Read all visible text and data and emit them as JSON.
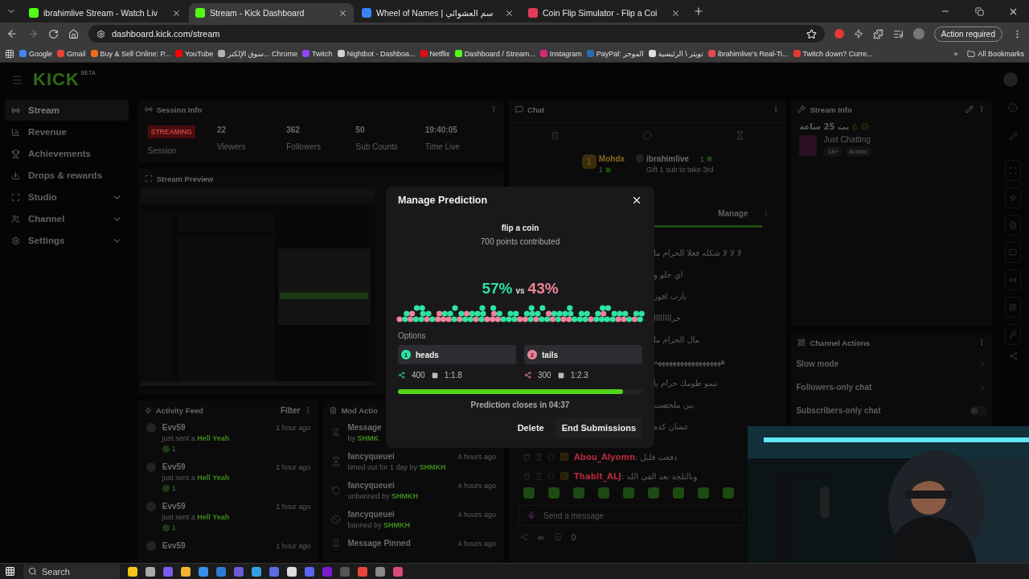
{
  "browser": {
    "tabs": [
      {
        "title": "ibrahimlive Stream - Watch Liv",
        "selected": false,
        "color": "#53fc18"
      },
      {
        "title": "Stream - Kick Dashboard",
        "selected": true,
        "color": "#53fc18"
      },
      {
        "title": "Wheel of Names | سم العشوائي",
        "selected": false,
        "color": "#3b82f6"
      },
      {
        "title": "Coin Flip Simulator - Flip a Coi",
        "selected": false,
        "color": "#e23b5a"
      }
    ],
    "address": "dashboard.kick.com/stream",
    "action_required": "Action required",
    "bookmarks": [
      {
        "label": "Google",
        "color": "#4285f4"
      },
      {
        "label": "Gmail",
        "color": "#ea4335"
      },
      {
        "label": "Buy & Sell Online: P...",
        "color": "#f26b1d"
      },
      {
        "label": "YouTube",
        "color": "#ff0000"
      },
      {
        "label": "سوق الإلكتر... Chrome",
        "color": "#b0b0b0"
      },
      {
        "label": "Twitch",
        "color": "#9146ff"
      },
      {
        "label": "Nightbot - Dashboa...",
        "color": "#d0d0d0"
      },
      {
        "label": "Netflix",
        "color": "#e50914"
      },
      {
        "label": "Dashboard / Stream...",
        "color": "#53fc18"
      },
      {
        "label": "Instagram",
        "color": "#d62976"
      },
      {
        "label": "PayPal: الموجز",
        "color": "#2b6cb0"
      },
      {
        "label": "تويتر \\ الرئيسية",
        "color": "#e0e0e0"
      },
      {
        "label": "ibrahimlive's Real-Ti...",
        "color": "#e34c4c"
      },
      {
        "label": "Twitch down? Curre...",
        "color": "#e53935"
      }
    ],
    "more": "»",
    "all_bookmarks": "All Bookmarks"
  },
  "header": {
    "logo": "KICK",
    "logo_badge": "BETA"
  },
  "sidebar": {
    "items": [
      {
        "label": "Stream",
        "selected": true,
        "kind": "stream",
        "expandable": false
      },
      {
        "label": "Revenue",
        "selected": false,
        "kind": "revenue",
        "expandable": false
      },
      {
        "label": "Achievements",
        "selected": false,
        "kind": "achievements",
        "expandable": false
      },
      {
        "label": "Drops & rewards",
        "selected": false,
        "kind": "drops",
        "expandable": false
      },
      {
        "label": "Studio",
        "selected": false,
        "kind": "studio",
        "expandable": true
      },
      {
        "label": "Channel",
        "selected": false,
        "kind": "channel",
        "expandable": true
      },
      {
        "label": "Settings",
        "selected": false,
        "kind": "settings",
        "expandable": true
      }
    ]
  },
  "session_info": {
    "title": "Session Info",
    "status": "STREAMING",
    "status_label": "Session",
    "stats": [
      {
        "value": "22",
        "label": "Viewers"
      },
      {
        "value": "362",
        "label": "Followers"
      },
      {
        "value": "50",
        "label": "Sub Counts"
      },
      {
        "value": "19:40:05",
        "label": "Time Live"
      }
    ]
  },
  "stream_preview": {
    "title": "Stream Preview"
  },
  "activity_feed": {
    "title": "Activity Feed",
    "filter": "Filter",
    "events": [
      {
        "user": "Evv59",
        "text": "just sent a",
        "reward": "Hell Yeah",
        "count": "1",
        "time": "1 hour ago"
      },
      {
        "user": "Evv59",
        "text": "just sent a",
        "reward": "Hell Yeah",
        "count": "1",
        "time": "1 hour ago"
      },
      {
        "user": "Evv59",
        "text": "just sent a",
        "reward": "Hell Yeah",
        "count": "1",
        "time": "1 hour ago"
      },
      {
        "user": "Evv59",
        "time": "1 hour ago"
      }
    ]
  },
  "mod_actions": {
    "title": "Mod Actio",
    "actions": [
      {
        "kind": "unpin",
        "title": "Message",
        "detail": "by",
        "moderator": "SHMK"
      },
      {
        "kind": "timeout",
        "title": "fancyqueuei",
        "detail": "timed out for 1 day by",
        "moderator": "SHMKH",
        "time": "4 hours ago"
      },
      {
        "kind": "unban",
        "title": "fancyqueuei",
        "detail": "unbanned by",
        "moderator": "SHMKH",
        "time": "4 hours ago"
      },
      {
        "kind": "ban",
        "title": "fancyqueuei",
        "detail": "banned by",
        "moderator": "SHMKH",
        "time": "4 hours ago"
      },
      {
        "kind": "pin",
        "title": "Message Pinned",
        "time": "4 hours ago"
      }
    ]
  },
  "chat": {
    "title": "Chat",
    "leaderboard": [
      {
        "rank": "1",
        "name": "Mohdx",
        "count": "1"
      },
      {
        "name": "ibrahimlive",
        "count": "1",
        "note": "Gift 1 sub to take 3rd"
      }
    ],
    "manage": "Manage",
    "messages": [
      "لا لا لا شكله فعلا الحرام ما",
      "اي حلو و",
      "يارب افوز",
      "حراااااااا",
      "مال الحرام ما",
      "ههههههههههههههههههه",
      "تيمو طومك حرام يا",
      "بين ملخصت",
      "عشان كده"
    ],
    "user_messages": [
      {
        "user": "Abou_Alyomn",
        "separator": ":",
        "text": "دفعت قليل",
        "color": "#b02a3c"
      },
      {
        "user": "Thabit_ALJ",
        "separator": ":",
        "text": "وبالثلجة بعد الفي الله",
        "color": "#b02a3c"
      }
    ],
    "input_placeholder": "Send a message",
    "points": "∞",
    "count": "0"
  },
  "stream_info": {
    "title": "Stream Info",
    "stream_title": "بث 25 ساعة",
    "category": "Just Chatting",
    "tags": [
      "18+",
      "Arabic"
    ]
  },
  "channel_actions": {
    "title": "Channel Actions",
    "items": [
      {
        "label": "Slow mode",
        "kind": "link"
      },
      {
        "label": "Followers-only chat",
        "kind": "link"
      },
      {
        "label": "Subscribers-only chat",
        "kind": "toggle",
        "on": false
      }
    ]
  },
  "modal": {
    "title": "Manage Prediction",
    "question": "flip a coin",
    "points": "700 points contributed",
    "percent_a": "57%",
    "vs": "vs",
    "percent_b": "43%",
    "options_label": "Options",
    "options": [
      {
        "number": "1",
        "label": "heads",
        "color": "#2fe3a0",
        "points": "400",
        "ratio": "1:1.8"
      },
      {
        "number": "2",
        "label": "tails",
        "color": "#f0849a",
        "points": "300",
        "ratio": "1:2.3"
      }
    ],
    "timer": {
      "level": 0.92
    },
    "closes": "Prediction closes in 04:37",
    "delete": "Delete",
    "end": "End Submissions"
  },
  "taskbar": {
    "search": "Search"
  }
}
